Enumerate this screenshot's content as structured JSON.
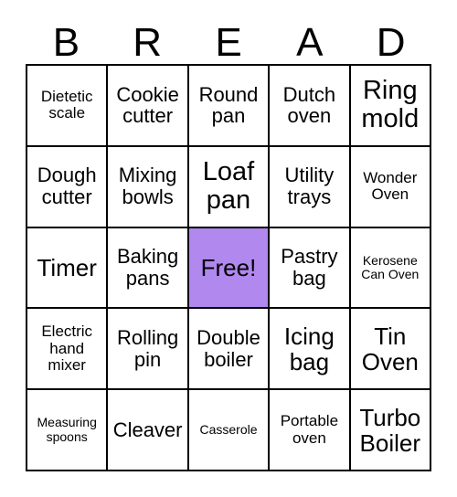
{
  "card": {
    "title_letters": [
      "B",
      "R",
      "E",
      "A",
      "D"
    ],
    "free_space_color": "#b088ee",
    "grid_line_color": "#000000",
    "background_color": "#ffffff",
    "columns": 5,
    "rows": 5,
    "cells": [
      {
        "text": "Dietetic scale",
        "size": "sm",
        "free": false
      },
      {
        "text": "Cookie cutter",
        "size": "md",
        "free": false
      },
      {
        "text": "Round pan",
        "size": "md",
        "free": false
      },
      {
        "text": "Dutch oven",
        "size": "md",
        "free": false
      },
      {
        "text": "Ring mold",
        "size": "xl",
        "free": false
      },
      {
        "text": "Dough cutter",
        "size": "md",
        "free": false
      },
      {
        "text": "Mixing bowls",
        "size": "md",
        "free": false
      },
      {
        "text": "Loaf pan",
        "size": "xl",
        "free": false
      },
      {
        "text": "Utility trays",
        "size": "md",
        "free": false
      },
      {
        "text": "Wonder Oven",
        "size": "sm",
        "free": false
      },
      {
        "text": "Timer",
        "size": "lg",
        "free": false
      },
      {
        "text": "Baking pans",
        "size": "md",
        "free": false
      },
      {
        "text": "Free!",
        "size": "lg",
        "free": true
      },
      {
        "text": "Pastry bag",
        "size": "md",
        "free": false
      },
      {
        "text": "Kerosene Can Oven",
        "size": "xs",
        "free": false
      },
      {
        "text": "Electric hand mixer",
        "size": "sm",
        "free": false
      },
      {
        "text": "Rolling pin",
        "size": "md",
        "free": false
      },
      {
        "text": "Double boiler",
        "size": "md",
        "free": false
      },
      {
        "text": "Icing bag",
        "size": "lg",
        "free": false
      },
      {
        "text": "Tin Oven",
        "size": "lg",
        "free": false
      },
      {
        "text": "Measuring spoons",
        "size": "xs",
        "free": false
      },
      {
        "text": "Cleaver",
        "size": "md",
        "free": false
      },
      {
        "text": "Casserole",
        "size": "xs",
        "free": false
      },
      {
        "text": "Portable oven",
        "size": "sm",
        "free": false
      },
      {
        "text": "Turbo Boiler",
        "size": "lg",
        "free": false
      }
    ]
  }
}
